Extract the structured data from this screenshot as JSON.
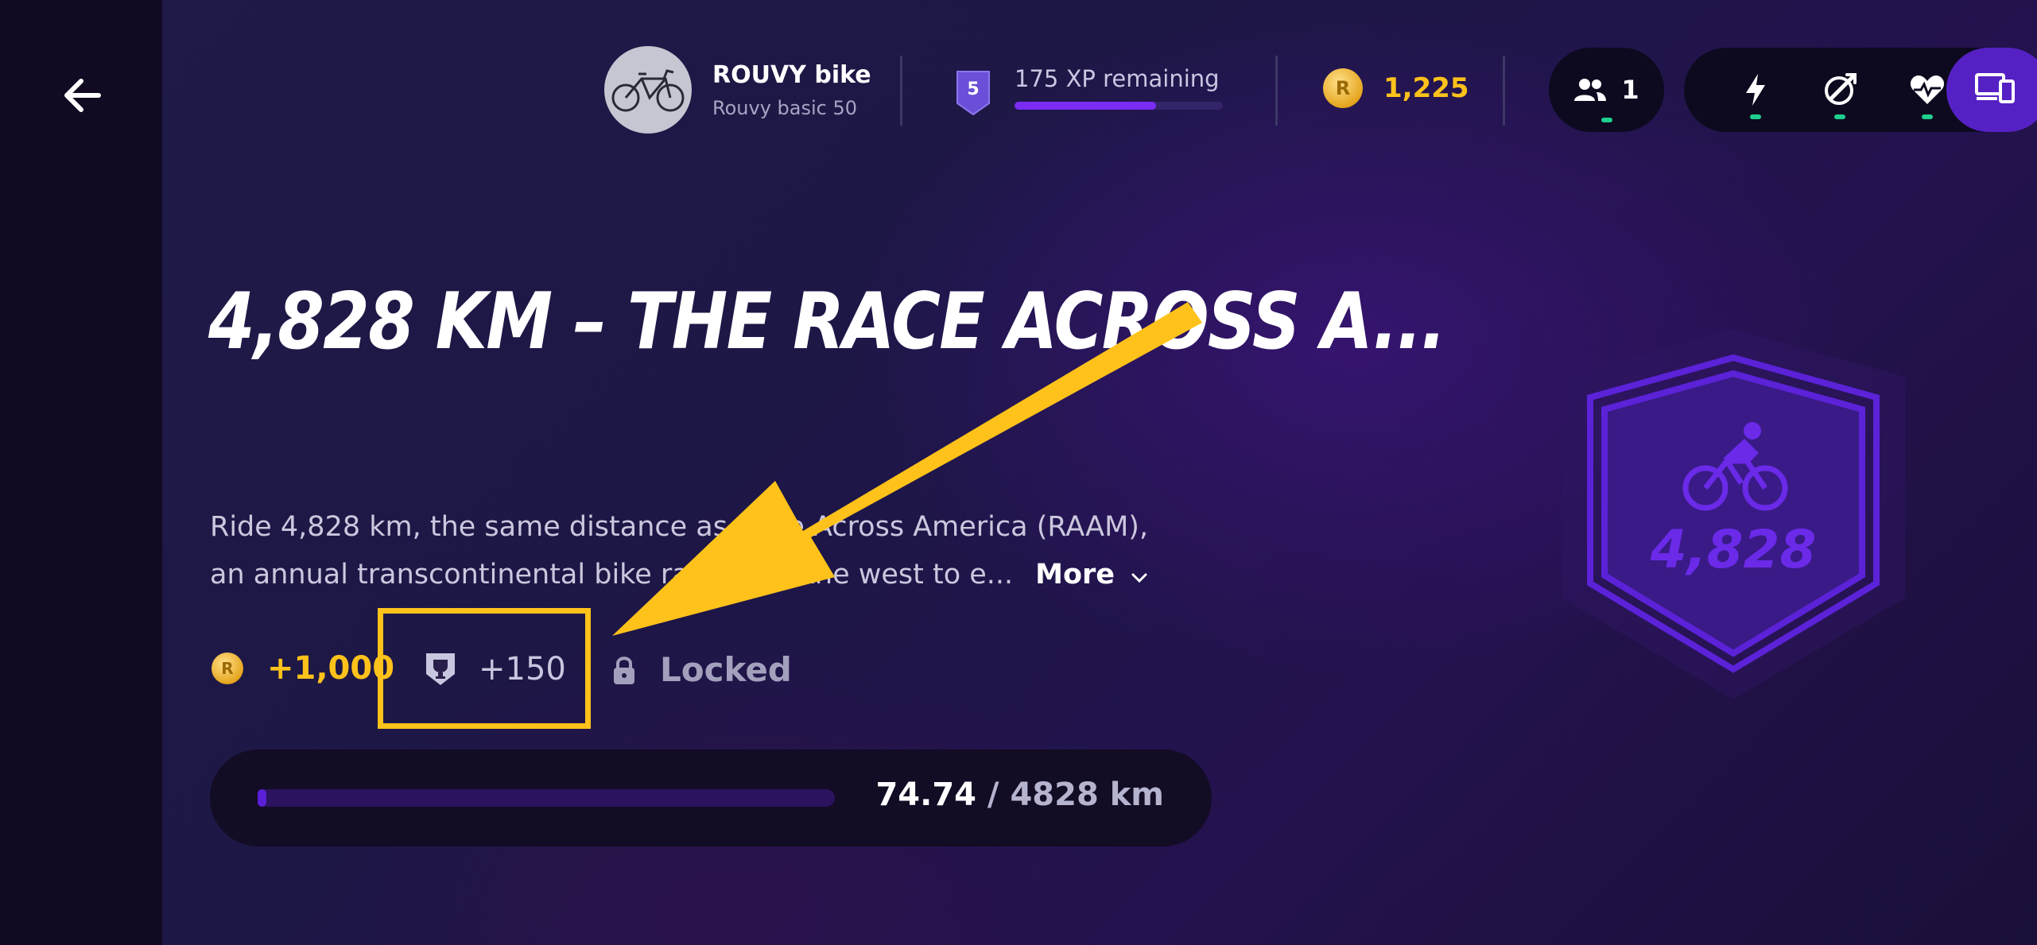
{
  "topbar": {
    "bike_name": "ROUVY bike",
    "bike_subtitle": "Rouvy basic 50",
    "level": "5",
    "xp_text": "175 XP remaining",
    "xp_progress": 0.68,
    "coins": "1,225",
    "coin_symbol": "R",
    "riders_count": "1",
    "devices": [
      "power-icon",
      "cadence-icon",
      "heart-rate-icon",
      "screens-icon"
    ]
  },
  "challenge": {
    "title": "4,828 KM – THE RACE ACROSS A...",
    "description_line1": "Ride 4,828 km, the same distance as Race Across America (RAAM),",
    "description_line2": "an annual transcontinental bike race from the west to e...",
    "more_label": "More",
    "coin_reward": "+1,000",
    "xp_reward": "+150",
    "status": "Locked",
    "progress_current": "74.74",
    "progress_sep": " / ",
    "progress_total": "4828 km",
    "progress_fraction": 0.0155,
    "badge_value": "4,828"
  },
  "colors": {
    "accent_purple": "#5a1fd6",
    "coin_gold": "#ffc21a",
    "highlight_yellow": "#ffc21a",
    "status_green": "#1fcf8e"
  }
}
